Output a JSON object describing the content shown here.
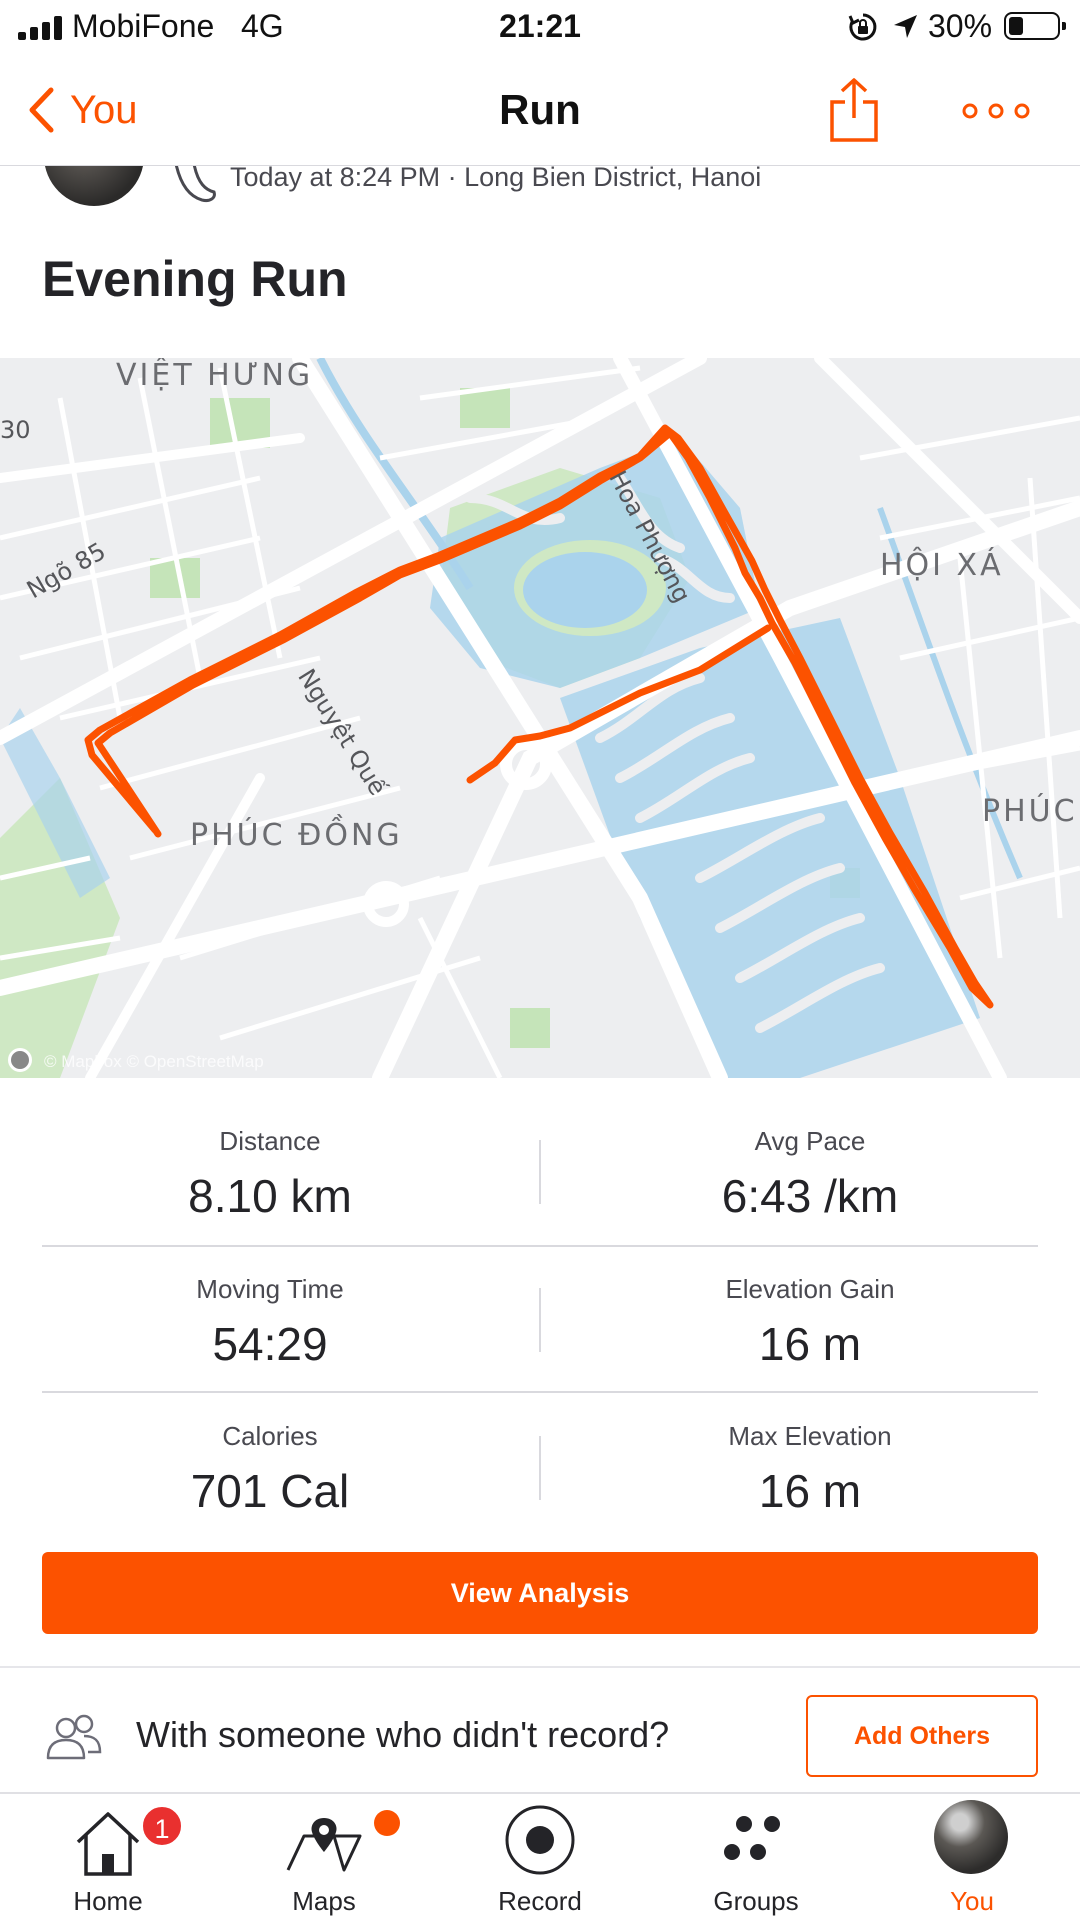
{
  "status_bar": {
    "carrier": "MobiFone",
    "network": "4G",
    "time": "21:21",
    "battery_percent": "30%",
    "battery_level": 0.3,
    "icons": [
      "signal-icon",
      "rotation-lock-icon",
      "location-arrow-icon",
      "battery-icon"
    ]
  },
  "nav": {
    "back_label": "You",
    "title": "Run",
    "share_icon": "share-icon",
    "more_icon": "more-icon"
  },
  "activity": {
    "meta": "Today at 8:24 PM · Long Bien District, Hanoi",
    "title": "Evening Run"
  },
  "map": {
    "labels": {
      "viet_hung": "VIỆT HƯNG",
      "hoi_xa": "HỘI XÁ",
      "phuc_dong": "PHÚC ĐỒNG",
      "phuc": "PHÚC"
    },
    "streets": {
      "ngo85": "Ngõ 85",
      "hoa_phuong": "Hoa Phượng",
      "nguyet_que": "Nguyệt Quế",
      "edge_number": "30"
    },
    "attribution": "© Mapbox © OpenStreetMap",
    "route_color": "#fc5200",
    "water_color": "#aad3ec",
    "park_color": "#cfe8c4"
  },
  "stats": [
    {
      "label": "Distance",
      "value": "8.10 km"
    },
    {
      "label": "Avg Pace",
      "value": "6:43 /km"
    },
    {
      "label": "Moving Time",
      "value": "54:29"
    },
    {
      "label": "Elevation Gain",
      "value": "16 m"
    },
    {
      "label": "Calories",
      "value": "701 Cal"
    },
    {
      "label": "Max Elevation",
      "value": "16 m"
    }
  ],
  "actions": {
    "view_analysis": "View Analysis",
    "with_someone": "With someone who didn't record?",
    "add_others": "Add Others"
  },
  "tabs": [
    {
      "label": "Home",
      "icon": "home-icon",
      "badge": "1"
    },
    {
      "label": "Maps",
      "icon": "maps-icon"
    },
    {
      "label": "Record",
      "icon": "record-icon"
    },
    {
      "label": "Groups",
      "icon": "groups-icon"
    },
    {
      "label": "You",
      "icon": "avatar",
      "active": true
    }
  ],
  "colors": {
    "accent": "#fc5200",
    "text": "#242428",
    "divider": "#d9d9de",
    "badge": "#e9302f"
  }
}
